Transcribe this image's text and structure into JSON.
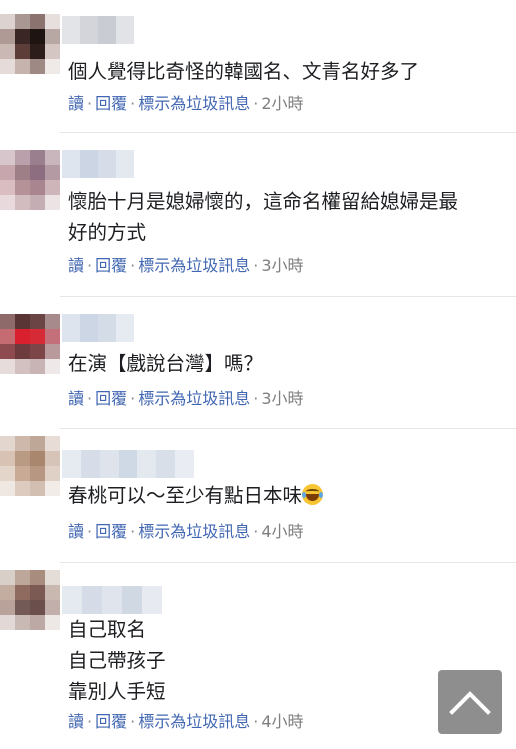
{
  "actions": {
    "read": "讀",
    "reply": "回覆",
    "mark_spam": "標示為垃圾訊息",
    "separator": "·"
  },
  "comments": [
    {
      "lines": [
        "個人覺得比奇怪的韓國名、文青名好多了"
      ],
      "time": "2小時"
    },
    {
      "lines": [
        "懷胎十月是媳婦懷的，這命名權留給媳婦是最",
        "好的方式"
      ],
      "time": "3小時"
    },
    {
      "lines": [
        "在演【戲說台灣】嗎？"
      ],
      "time": "3小時"
    },
    {
      "lines": [
        "春桃可以～至少有點日本味"
      ],
      "emoji": "grinning-squinting-face-with-tears-emoji",
      "time": "4小時"
    },
    {
      "lines": [
        "自己取名",
        "自己帶孩子",
        "靠別人手短"
      ],
      "time": "4小時"
    }
  ],
  "scroll_top_icon": "chevron-up-icon",
  "colors": {
    "link": "#4267b2",
    "meta": "#7f7f7f",
    "text": "#1c1e21",
    "scroll_button": "#8e8e8e"
  }
}
